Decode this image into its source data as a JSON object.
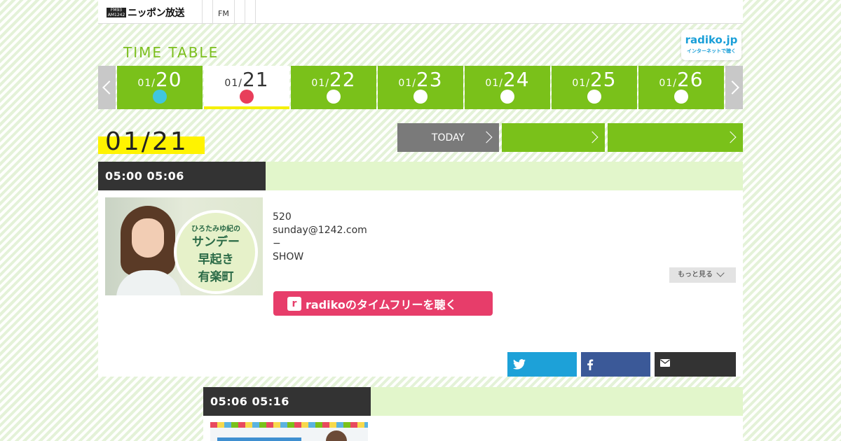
{
  "header": {
    "logo_mark": "FM93 AM1242",
    "logo_text": "ニッポン放送",
    "nav": [
      "FM",
      "",
      ""
    ]
  },
  "timetable": {
    "title": "TIME TABLE",
    "radiko": {
      "title": "radiko.jp",
      "sub": "インターネットで聴く"
    }
  },
  "days": [
    {
      "month": "01/",
      "day": "20",
      "dot_color": "#3fc6de",
      "selected": false
    },
    {
      "month": "01/",
      "day": "21",
      "dot_color": "#e83e5a",
      "selected": true
    },
    {
      "month": "01/",
      "day": "22",
      "dot_color": "#ffffff",
      "selected": false
    },
    {
      "month": "01/",
      "day": "23",
      "dot_color": "#ffffff",
      "selected": false
    },
    {
      "month": "01/",
      "day": "24",
      "dot_color": "#ffffff",
      "selected": false
    },
    {
      "month": "01/",
      "day": "25",
      "dot_color": "#ffffff",
      "selected": false
    },
    {
      "month": "01/",
      "day": "26",
      "dot_color": "#ffffff",
      "selected": false
    }
  ],
  "current_date": "01/21",
  "buttons": {
    "today": "TODAY",
    "green1": "",
    "green2": ""
  },
  "program1": {
    "time": "05:00  05:06",
    "thumb": {
      "line1": "ひろたみゆ紀の",
      "line2": "サンデー",
      "line3": "早起き",
      "line4": "有楽町"
    },
    "info": [
      "520",
      "sunday@1242.com",
      "−",
      "SHOW"
    ],
    "more": "もっと見る",
    "radiko_button": "radikoのタイムフリーを聴く",
    "radiko_logo": "r"
  },
  "program2": {
    "time": "05:06  05:16"
  },
  "colors": {
    "green": "#7ac11a",
    "light_green": "#e2f6cb",
    "yellow": "#fff300",
    "radiko_pink": "#e73d6a",
    "twitter": "#1da1d8",
    "facebook": "#3b5998"
  },
  "icons": {
    "twitter": "twitter-icon",
    "facebook": "facebook-icon",
    "mail": "mail-icon"
  }
}
